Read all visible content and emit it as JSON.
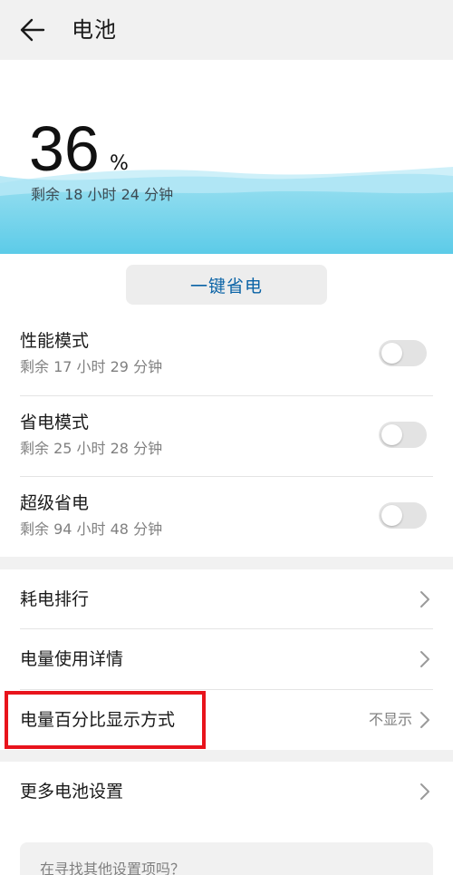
{
  "header": {
    "title": "电池",
    "back_icon": "arrow-left-icon"
  },
  "battery": {
    "percent": "36",
    "percent_sign": "%",
    "remaining": "剩余 18 小时 24 分钟"
  },
  "one_tap_save": {
    "label": "一键省电"
  },
  "modes": [
    {
      "title": "性能模式",
      "subtitle": "剩余 17 小时 29 分钟",
      "enabled": false
    },
    {
      "title": "省电模式",
      "subtitle": "剩余 25 小时 28 分钟",
      "enabled": false
    },
    {
      "title": "超级省电",
      "subtitle": "剩余 94 小时 48 分钟",
      "enabled": false
    }
  ],
  "list": [
    {
      "label": "耗电排行",
      "value": ""
    },
    {
      "label": "电量使用详情",
      "value": ""
    },
    {
      "label": "电量百分比显示方式",
      "value": "不显示"
    }
  ],
  "more": {
    "label": "更多电池设置"
  },
  "suggestion": {
    "text": "在寻找其他设置项吗？"
  },
  "colors": {
    "accent": "#0a63a6",
    "wave": "#5ccbe8",
    "highlight": "#e8141c"
  }
}
